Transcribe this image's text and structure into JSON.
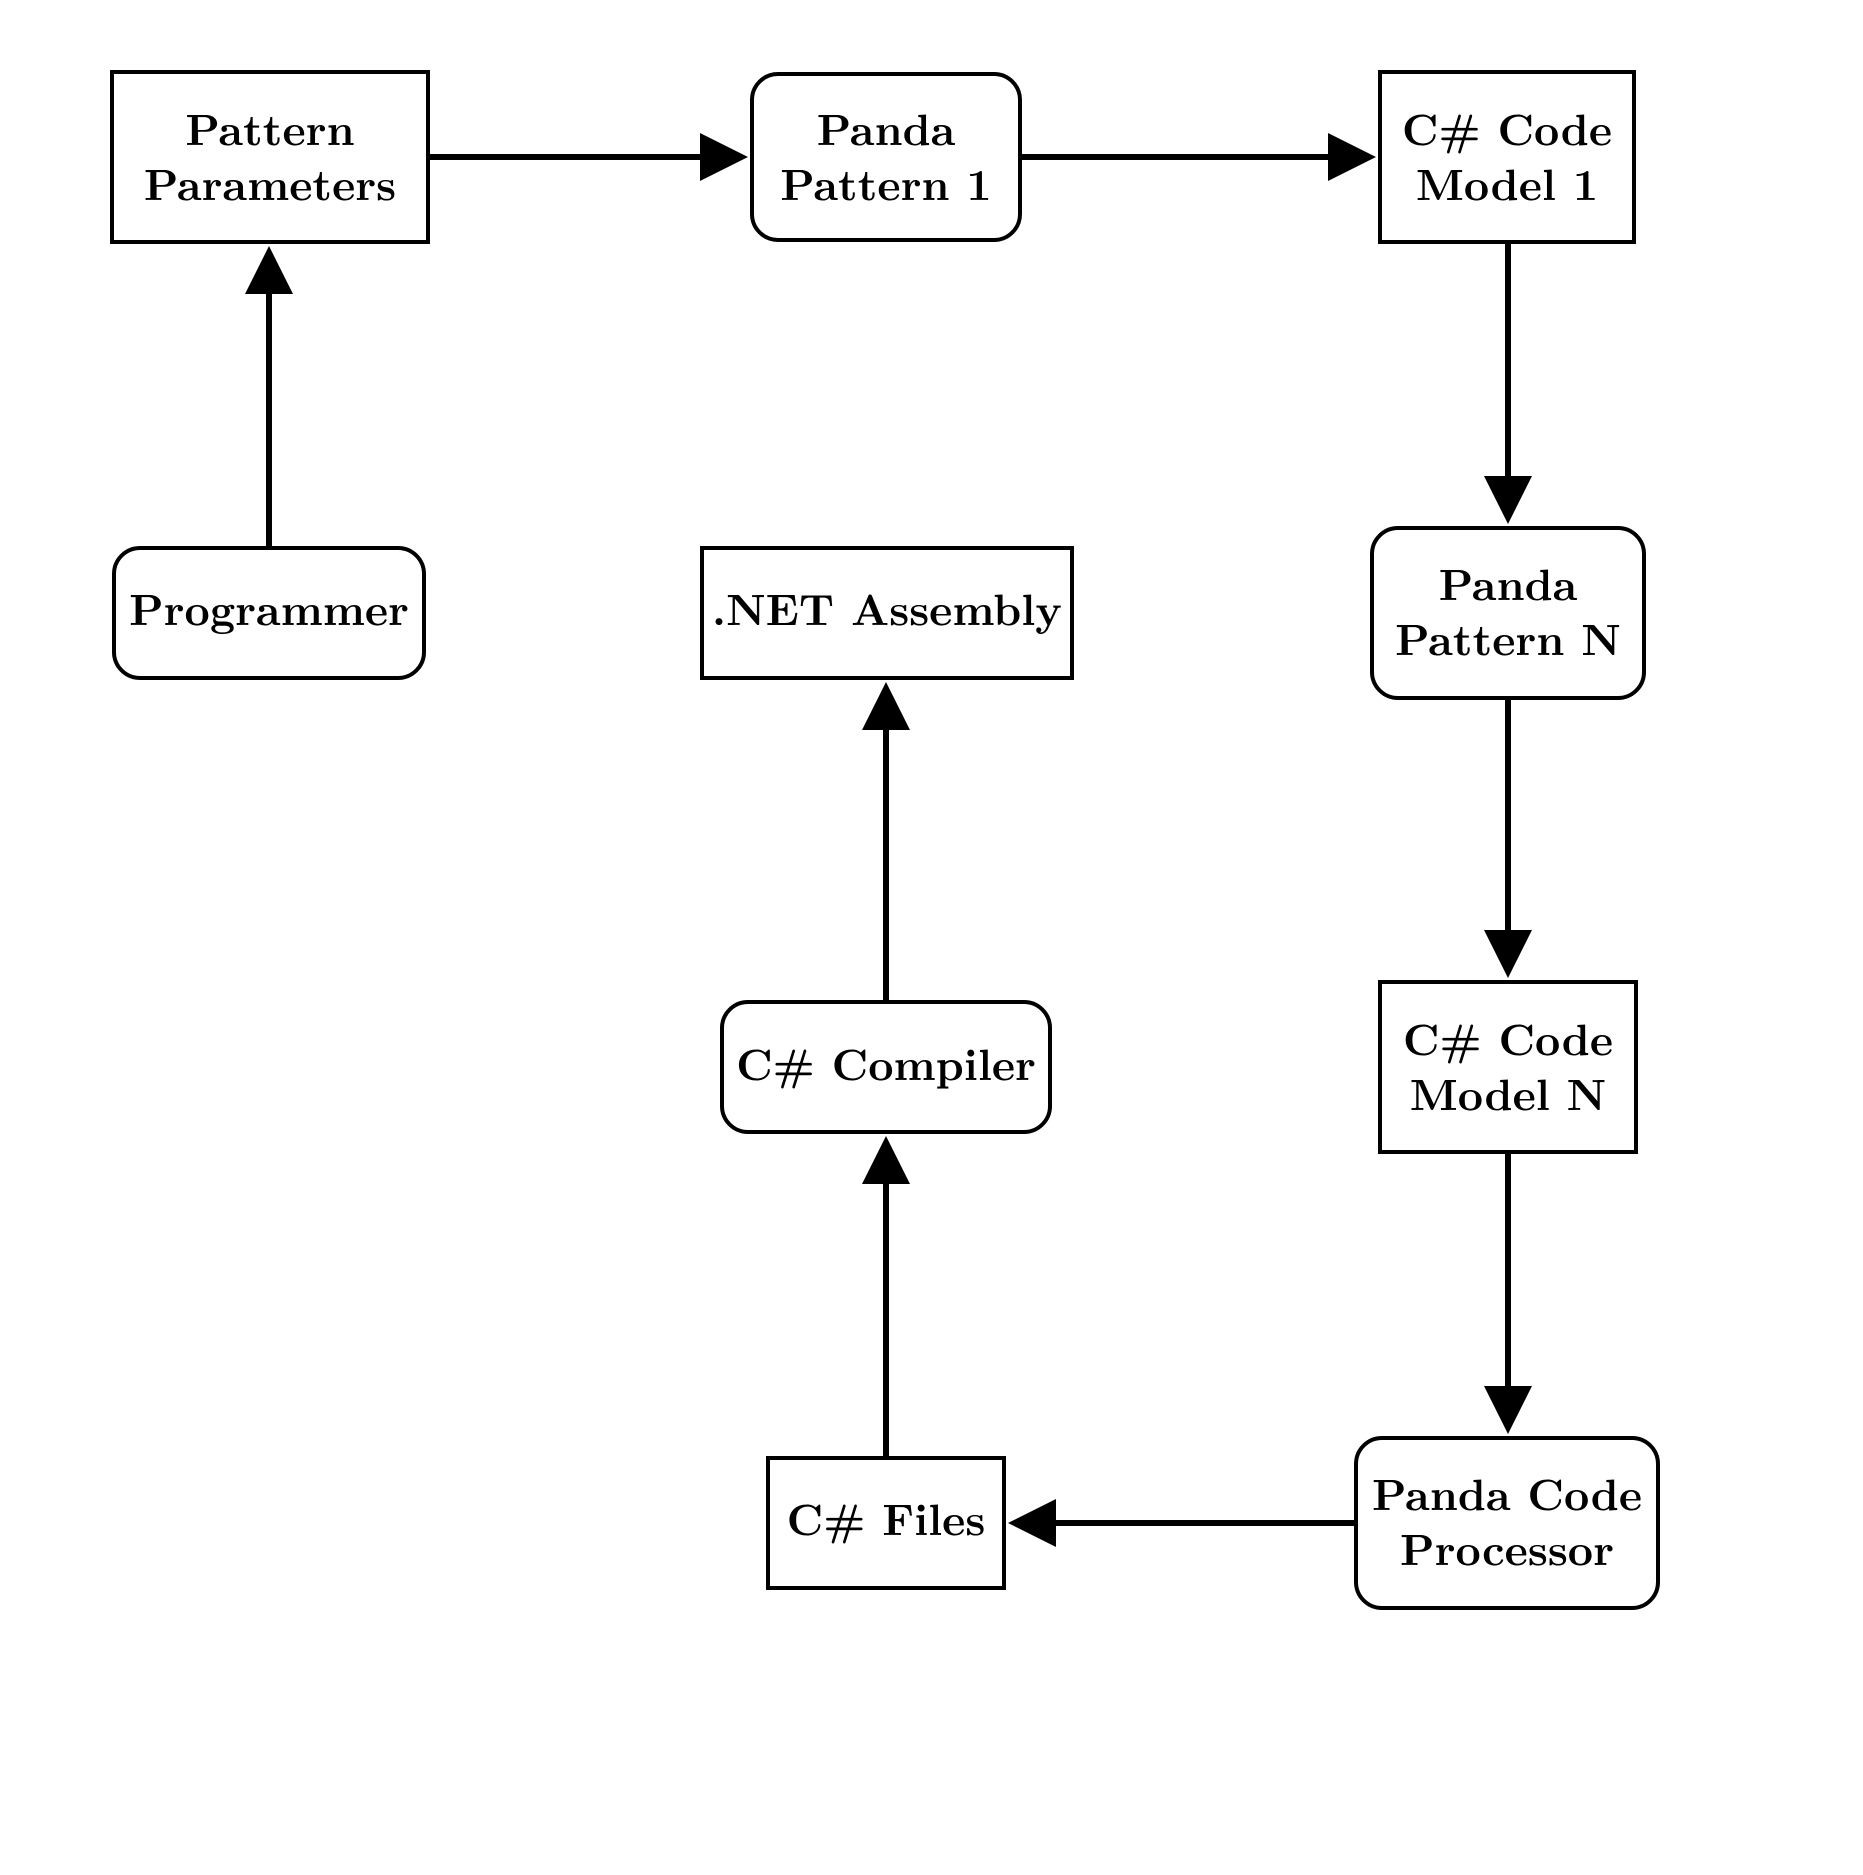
{
  "nodes": {
    "pattern_params": {
      "line1": "Pattern",
      "line2": "Parameters"
    },
    "panda_pattern_1": {
      "line1": "Panda",
      "line2": "Pattern 1"
    },
    "code_model_1": {
      "line1": "C# Code",
      "line2": "Model 1"
    },
    "programmer": {
      "line1": "Programmer"
    },
    "net_assembly": {
      "line1": ".NET Assembly"
    },
    "panda_pattern_n": {
      "line1": "Panda",
      "line2": "Pattern N"
    },
    "csharp_compiler": {
      "line1": "C# Compiler"
    },
    "code_model_n": {
      "line1": "C# Code",
      "line2": "Model N"
    },
    "csharp_files": {
      "line1": "C# Files"
    },
    "code_processor": {
      "line1": "Panda Code",
      "line2": "Processor"
    }
  },
  "diagram": {
    "flow": [
      "programmer -> pattern_params",
      "pattern_params -> panda_pattern_1",
      "panda_pattern_1 -> code_model_1",
      "code_model_1 -> panda_pattern_n",
      "panda_pattern_n -> code_model_n",
      "code_model_n -> code_processor",
      "code_processor -> csharp_files",
      "csharp_files -> csharp_compiler",
      "csharp_compiler -> net_assembly"
    ]
  }
}
